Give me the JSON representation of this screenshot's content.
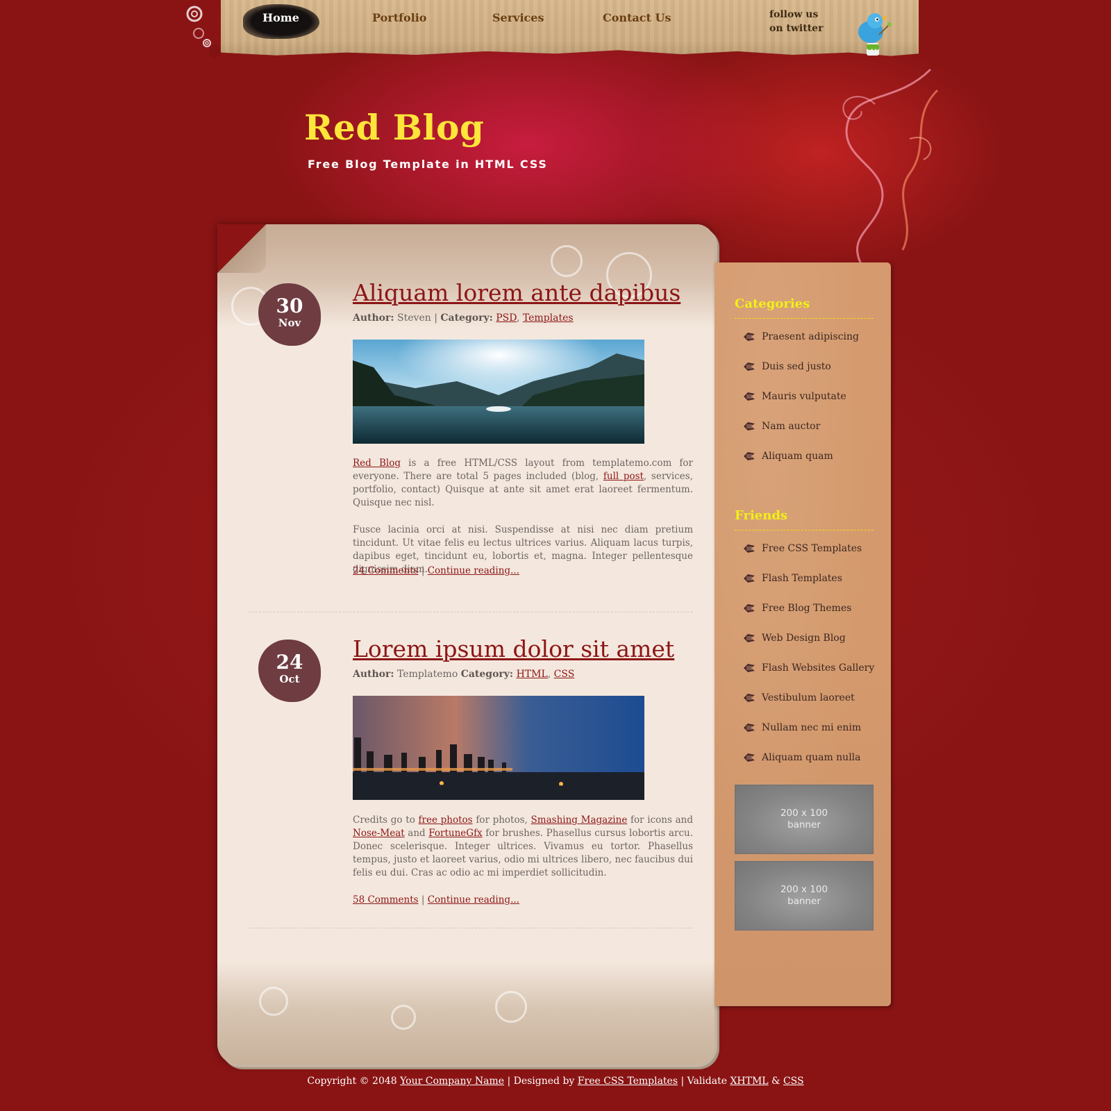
{
  "nav": {
    "items": [
      {
        "label": "Home",
        "active": true
      },
      {
        "label": "Portfolio",
        "active": false
      },
      {
        "label": "Services",
        "active": false
      },
      {
        "label": "Contact Us",
        "active": false
      }
    ],
    "twitter": {
      "line1": "follow us",
      "line2": "on twitter",
      "icon": "twitter-bird-icon"
    }
  },
  "header": {
    "title": "Red Blog",
    "subtitle": "Free Blog Template in HTML CSS"
  },
  "posts": [
    {
      "day": "30",
      "month": "Nov",
      "title": "Aliquam lorem ante dapibus",
      "author_label": "Author:",
      "author": "Steven",
      "separator": "|",
      "category_label": "Category:",
      "categories": [
        "PSD",
        "Templates"
      ],
      "image_alt": "mountain lake landscape",
      "paragraph1": {
        "link1": "Red Blog",
        "text1": " is a free HTML/CSS layout from templatemo.com for everyone. There are total 5 pages included (blog, ",
        "link2": "full post",
        "text2": ", services, portfolio, contact) Quisque at ante sit amet erat laoreet fermentum. Quisque nec nisl."
      },
      "paragraph2": "Fusce lacinia orci at nisi. Suspendisse at nisi nec diam pretium tincidunt. Ut vitae felis eu lectus ultrices varius. Aliquam lacus turpis, dapibus eget, tincidunt eu, lobortis et, magna. Integer pellentesque dignissim diam.",
      "comments": "24 Comments",
      "continue": "Continue reading..."
    },
    {
      "day": "24",
      "month": "Oct",
      "title": "Lorem ipsum dolor sit amet",
      "author_label": "Author:",
      "author": "Templatemo",
      "category_label": "Category:",
      "categories": [
        "HTML",
        "CSS"
      ],
      "image_alt": "city skyline at dusk",
      "paragraph1": {
        "text0": "Credits go to ",
        "link1": "free photos",
        "text1": " for photos, ",
        "link2": "Smashing Magazine",
        "text2": " for icons and ",
        "link3": "Nose-Meat",
        "text3": " and ",
        "link4": "FortuneGfx",
        "text4": " for brushes. Phasellus cursus lobortis arcu. Donec scelerisque. Integer ultrices. Vivamus eu tortor. Phasellus tempus, justo et laoreet varius, odio mi ultrices libero, nec faucibus dui felis eu dui. Cras ac odio ac mi imperdiet sollicitudin."
      },
      "comments": "58 Comments",
      "continue": "Continue reading..."
    }
  ],
  "sidebar": {
    "categories": {
      "heading": "Categories",
      "items": [
        "Praesent adipiscing",
        "Duis sed justo",
        "Mauris vulputate",
        "Nam auctor",
        "Aliquam quam"
      ]
    },
    "friends": {
      "heading": "Friends",
      "items": [
        "Free CSS Templates",
        "Flash Templates",
        "Free Blog Themes",
        "Web Design Blog",
        "Flash Websites Gallery",
        "Vestibulum laoreet",
        "Nullam nec mi enim",
        "Aliquam quam nulla"
      ]
    },
    "banners": [
      {
        "line1": "200 x 100",
        "line2": "banner"
      },
      {
        "line1": "200 x 100",
        "line2": "banner"
      }
    ]
  },
  "footer": {
    "copyright": "Copyright © 2048 ",
    "company": "Your Company Name",
    "designed_by": " | Designed by ",
    "designer": "Free CSS Templates",
    "validate": " | Validate ",
    "xhtml": "XHTML",
    "amp": " & ",
    "css": "CSS"
  },
  "colors": {
    "accent_title": "#fde53a",
    "link": "#8c1616",
    "sidebar_heading": "#f2f016",
    "background": "#8a1414"
  }
}
